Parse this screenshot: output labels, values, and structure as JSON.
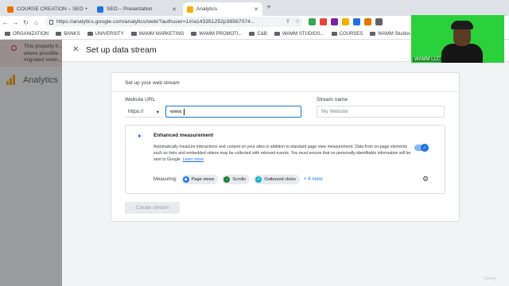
{
  "browser": {
    "tabs": [
      {
        "title": "COURSE CREATION – SEO +",
        "color": "#e37400"
      },
      {
        "title": "SEO – Presentation",
        "color": "#1a73e8"
      },
      {
        "title": "Analytics",
        "color": "#f9ab00"
      }
    ],
    "url": "https://analytics.google.com/analytics/web/?authuser=1#/a143351252p36567074..."
  },
  "bookmarks": [
    "ORGANIZATION",
    "BANKS",
    "UNIVERSITY",
    "WAMM MARKETING",
    "WAMM PROMOTI...",
    "C&B",
    "WAMM STUDIOS...",
    "COURSES",
    "WAMM Studios FLA..."
  ],
  "background_page": {
    "banner_text": "This property h... where possible ... migrated settin...",
    "app_name": "Analytics"
  },
  "panel": {
    "title": "Set up data stream",
    "card_heading": "Set up your web stream",
    "website_url_label": "Website URL",
    "protocol": "https://",
    "url_value": "www.",
    "stream_name_label": "Stream name",
    "stream_name_placeholder": "My Website",
    "enhanced": {
      "title": "Enhanced measurement",
      "desc_bold": "Automatically measure interactions and content on your sites in addition to standard page view measurement.",
      "desc": "Data from on-page elements such as links and embedded videos may be collected with relevant events. You must ensure that no personally-identifiable information will be sent to Google.",
      "learn_more": "Learn more",
      "enabled": true,
      "measuring_label": "Measuring:",
      "chips": [
        "Page views",
        "Scrolls",
        "Outbound clicks"
      ],
      "more": "+ 4 more"
    },
    "create_button": "Create stream"
  },
  "webcam": {
    "label": "WAMM LLC"
  },
  "watermark": "Udemy"
}
